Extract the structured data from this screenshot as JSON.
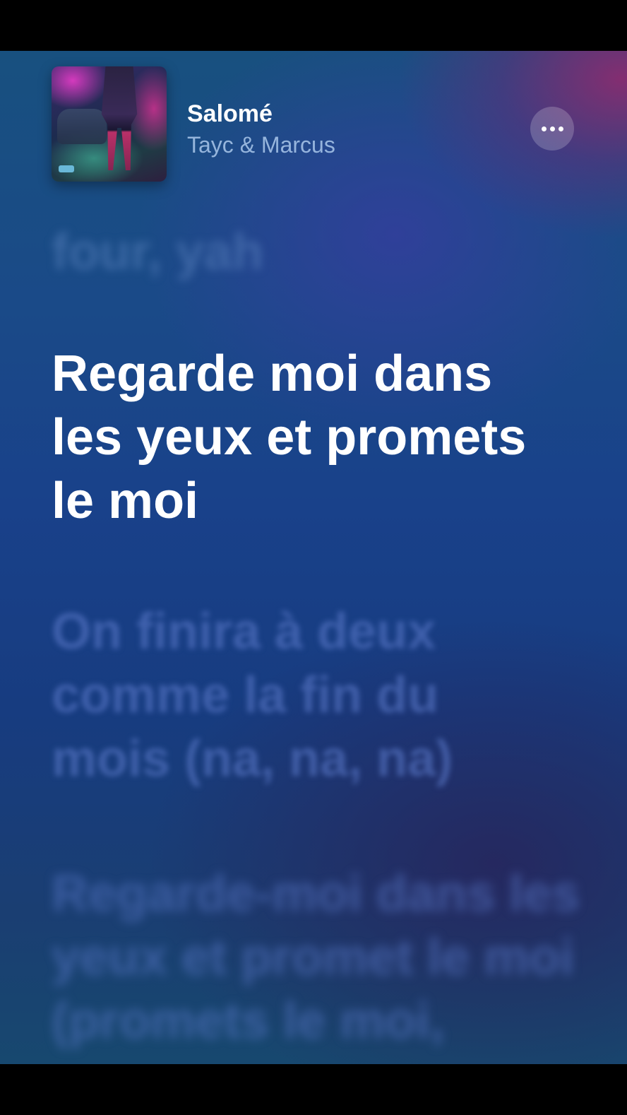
{
  "now_playing": {
    "title": "Salomé",
    "artist": "Tayc & Marcus"
  },
  "more_button": {
    "icon": "ellipsis-icon"
  },
  "lyrics": {
    "previous": "four, yah",
    "current": "Regarde moi dans les yeux et promets le moi",
    "next": [
      "On finira à deux comme la fin du mois (na, na, na)",
      "Regarde-moi dans les yeux et promet le moi (promets le moi,"
    ]
  },
  "colors": {
    "background_top": "#18507f",
    "background_accent": "#962e6e",
    "current_lyric": "#ffffff",
    "upcoming_lyric": "#5a78c8"
  }
}
